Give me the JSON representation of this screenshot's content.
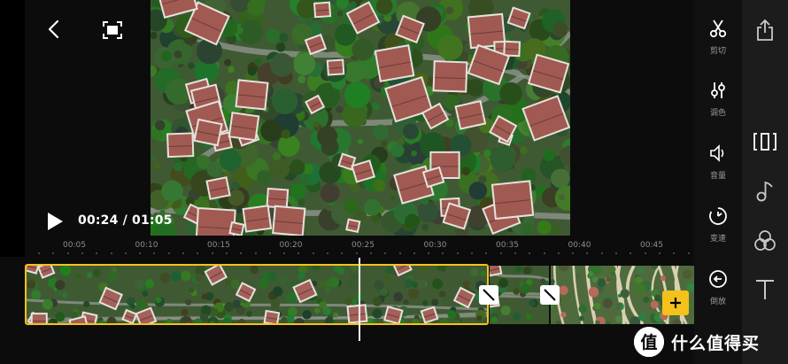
{
  "player": {
    "timecode": "00:24 / 01:05"
  },
  "ruler": {
    "ticks": [
      "00:05",
      "00:10",
      "00:15",
      "00:20",
      "00:25",
      "00:30",
      "00:35",
      "00:40",
      "00:45"
    ]
  },
  "tools": [
    {
      "icon": "scissors-icon",
      "label": "剪切"
    },
    {
      "icon": "adjust-sliders-icon",
      "label": "调色"
    },
    {
      "icon": "volume-icon",
      "label": "音量"
    },
    {
      "icon": "speed-icon",
      "label": "变速"
    },
    {
      "icon": "reverse-icon",
      "label": "倒放"
    }
  ],
  "side_panel": {
    "icons": [
      "share-icon",
      "split-view-icon",
      "music-note-icon",
      "filter-icon",
      "text-icon"
    ]
  },
  "watermark": {
    "badge": "值",
    "text": "什么值得买"
  },
  "colors": {
    "accent": "#f4c21a",
    "background": "#000000",
    "panel": "#111111"
  }
}
